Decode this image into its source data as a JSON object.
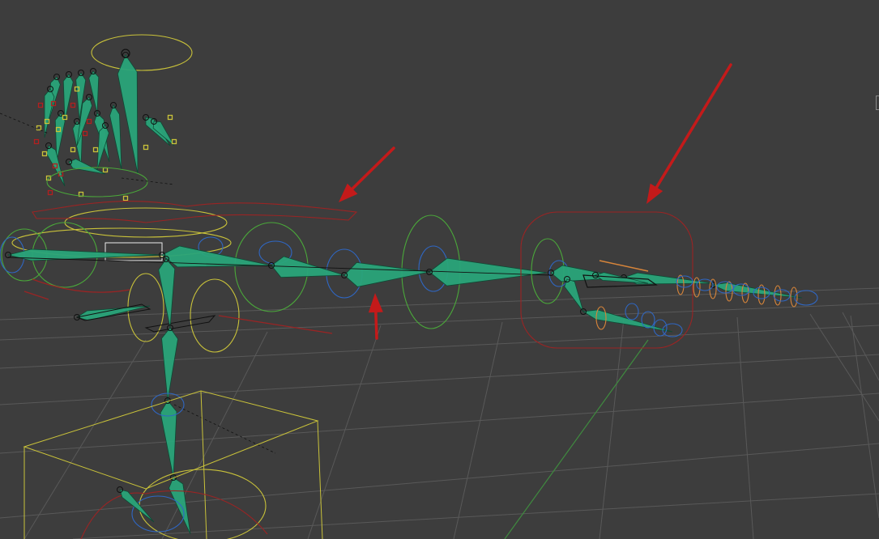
{
  "app": {
    "view": "3d-viewport"
  },
  "viewport": {
    "background_color": "#3d3d3d",
    "grid_color": "#595959",
    "axis_y_color": "#3f8a3f"
  },
  "colors": {
    "bone_fill": "#2aa57a",
    "bone_stroke": "#0c4a34",
    "control_green": "#4aa83a",
    "control_yellow": "#c9c23a",
    "control_blue": "#2f67c4",
    "control_red": "#9a2424",
    "control_orange": "#d8853a",
    "annotation_arrow": "#c41a1a"
  },
  "annotations": [
    {
      "name": "arrow-pointing-forearm-control",
      "icon": "arrow-icon"
    },
    {
      "name": "arrow-pointing-hand-control-box",
      "icon": "arrow-icon"
    },
    {
      "name": "arrow-pointing-arm-chain",
      "icon": "arrow-icon"
    }
  ]
}
